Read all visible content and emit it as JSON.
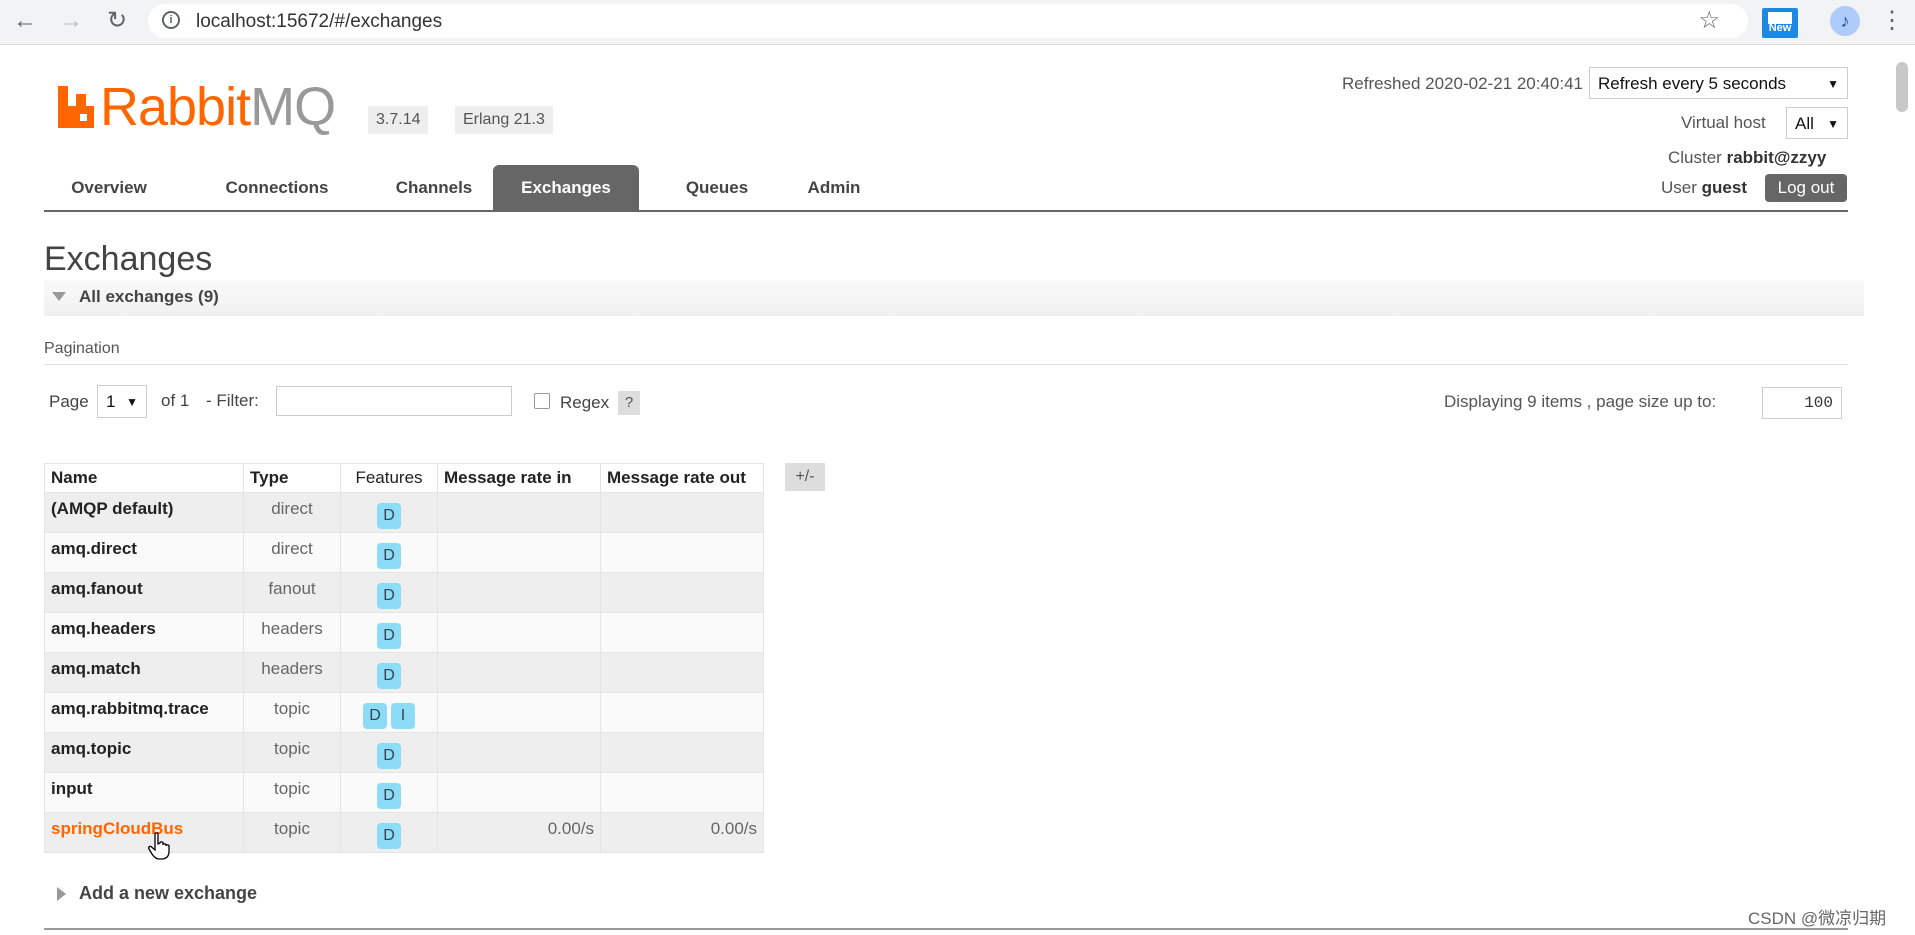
{
  "browser": {
    "url": "localhost:15672/#/exchanges",
    "info_icon": "i",
    "back_icon": "←",
    "forward_icon": "→",
    "reload_icon": "↻",
    "star_icon": "☆",
    "extension_label": "New",
    "profile_icon": "♪",
    "menu_icon": "⋮"
  },
  "header": {
    "logo_rabbit": "Rabbit",
    "logo_mq": "MQ",
    "version": "3.7.14",
    "erlang": "Erlang 21.3",
    "refreshed": "Refreshed 2020-02-21 20:40:41",
    "refresh_select": "Refresh every 5 seconds",
    "virtual_host_label": "Virtual host",
    "virtual_host_value": "All",
    "cluster_label": "Cluster",
    "cluster_value": "rabbit@zzyy",
    "user_label": "User",
    "user_value": "guest",
    "logout_label": "Log out"
  },
  "tabs": [
    {
      "label": "Overview",
      "active": false
    },
    {
      "label": "Connections",
      "active": false
    },
    {
      "label": "Channels",
      "active": false
    },
    {
      "label": "Exchanges",
      "active": true
    },
    {
      "label": "Queues",
      "active": false
    },
    {
      "label": "Admin",
      "active": false
    }
  ],
  "main": {
    "title": "Exchanges",
    "section_label": "All exchanges (9)",
    "pagination_label": "Pagination",
    "page_label": "Page",
    "page_value": "1",
    "of_label": "of 1",
    "filter_label": "- Filter:",
    "filter_value": "",
    "regex_label": "Regex",
    "help_label": "?",
    "displaying_label": "Displaying 9 items , page size up to:",
    "page_size": "100",
    "add_exchange_label": "Add a new exchange"
  },
  "table": {
    "headers": [
      "Name",
      "Type",
      "Features",
      "Message rate in",
      "Message rate out"
    ],
    "toggle_label": "+/-",
    "rows": [
      {
        "name": "(AMQP default)",
        "type": "direct",
        "features": [
          "D"
        ],
        "rate_in": "",
        "rate_out": ""
      },
      {
        "name": "amq.direct",
        "type": "direct",
        "features": [
          "D"
        ],
        "rate_in": "",
        "rate_out": ""
      },
      {
        "name": "amq.fanout",
        "type": "fanout",
        "features": [
          "D"
        ],
        "rate_in": "",
        "rate_out": ""
      },
      {
        "name": "amq.headers",
        "type": "headers",
        "features": [
          "D"
        ],
        "rate_in": "",
        "rate_out": ""
      },
      {
        "name": "amq.match",
        "type": "headers",
        "features": [
          "D"
        ],
        "rate_in": "",
        "rate_out": ""
      },
      {
        "name": "amq.rabbitmq.trace",
        "type": "topic",
        "features": [
          "D",
          "I"
        ],
        "rate_in": "",
        "rate_out": ""
      },
      {
        "name": "amq.topic",
        "type": "topic",
        "features": [
          "D"
        ],
        "rate_in": "",
        "rate_out": ""
      },
      {
        "name": "input",
        "type": "topic",
        "features": [
          "D"
        ],
        "rate_in": "",
        "rate_out": ""
      },
      {
        "name": "springCloudBus",
        "type": "topic",
        "features": [
          "D"
        ],
        "rate_in": "0.00/s",
        "rate_out": "0.00/s",
        "hovered": true
      }
    ]
  },
  "watermark": "CSDN @微凉归期",
  "colors": {
    "brand": "#ff6600",
    "tab_active": "#666666",
    "badge": "#8ddcf7"
  }
}
